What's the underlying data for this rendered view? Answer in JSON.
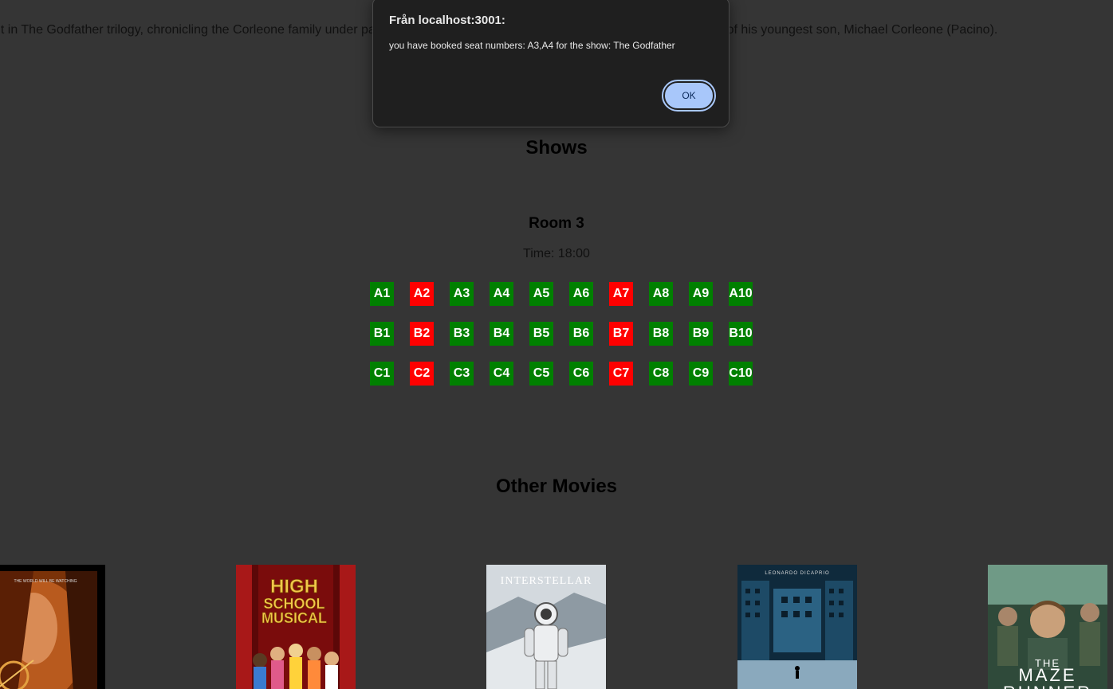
{
  "movie": {
    "description": "nt in The Godfather trilogy, chronicling the Corleone family under patriarch Vito Corleone (Brando), focusing on the transformation of his youngest son, Michael Corleone (Pacino)."
  },
  "shows": {
    "title": "Shows",
    "room": "Room 3",
    "time": "Time: 18:00",
    "seat_colors": {
      "available": "#008000",
      "booked": "#ff0000"
    },
    "rows": [
      {
        "seats": [
          {
            "label": "A1",
            "status": "available"
          },
          {
            "label": "A2",
            "status": "booked"
          },
          {
            "label": "A3",
            "status": "available"
          },
          {
            "label": "A4",
            "status": "available"
          },
          {
            "label": "A5",
            "status": "available"
          },
          {
            "label": "A6",
            "status": "available"
          },
          {
            "label": "A7",
            "status": "booked"
          },
          {
            "label": "A8",
            "status": "available"
          },
          {
            "label": "A9",
            "status": "available"
          },
          {
            "label": "A10",
            "status": "available"
          }
        ]
      },
      {
        "seats": [
          {
            "label": "B1",
            "status": "available"
          },
          {
            "label": "B2",
            "status": "booked"
          },
          {
            "label": "B3",
            "status": "available"
          },
          {
            "label": "B4",
            "status": "available"
          },
          {
            "label": "B5",
            "status": "available"
          },
          {
            "label": "B6",
            "status": "available"
          },
          {
            "label": "B7",
            "status": "booked"
          },
          {
            "label": "B8",
            "status": "available"
          },
          {
            "label": "B9",
            "status": "available"
          },
          {
            "label": "B10",
            "status": "available"
          }
        ]
      },
      {
        "seats": [
          {
            "label": "C1",
            "status": "available"
          },
          {
            "label": "C2",
            "status": "booked"
          },
          {
            "label": "C3",
            "status": "available"
          },
          {
            "label": "C4",
            "status": "available"
          },
          {
            "label": "C5",
            "status": "available"
          },
          {
            "label": "C6",
            "status": "available"
          },
          {
            "label": "C7",
            "status": "booked"
          },
          {
            "label": "C8",
            "status": "available"
          },
          {
            "label": "C9",
            "status": "available"
          },
          {
            "label": "C10",
            "status": "available"
          }
        ]
      }
    ]
  },
  "other_movies": {
    "title": "Other Movies",
    "posters": [
      {
        "name": "hunger-games-poster",
        "tagline": "THE WORLD WILL BE WATCHING"
      },
      {
        "name": "high-school-musical-poster",
        "title_lines": [
          "HIGH",
          "SCHOOL",
          "MUSICAL"
        ]
      },
      {
        "name": "interstellar-poster",
        "title": "INTERSTELLAR"
      },
      {
        "name": "inception-poster",
        "credit": "LEONARDO DICAPRIO"
      },
      {
        "name": "maze-runner-poster",
        "title_lines": [
          "THE",
          "MAZE",
          "RUNNER"
        ]
      }
    ]
  },
  "dialog": {
    "title": "Från localhost:3001:",
    "message": "you have booked seat numbers: A3,A4 for the show: The Godfather",
    "ok_label": "OK"
  }
}
